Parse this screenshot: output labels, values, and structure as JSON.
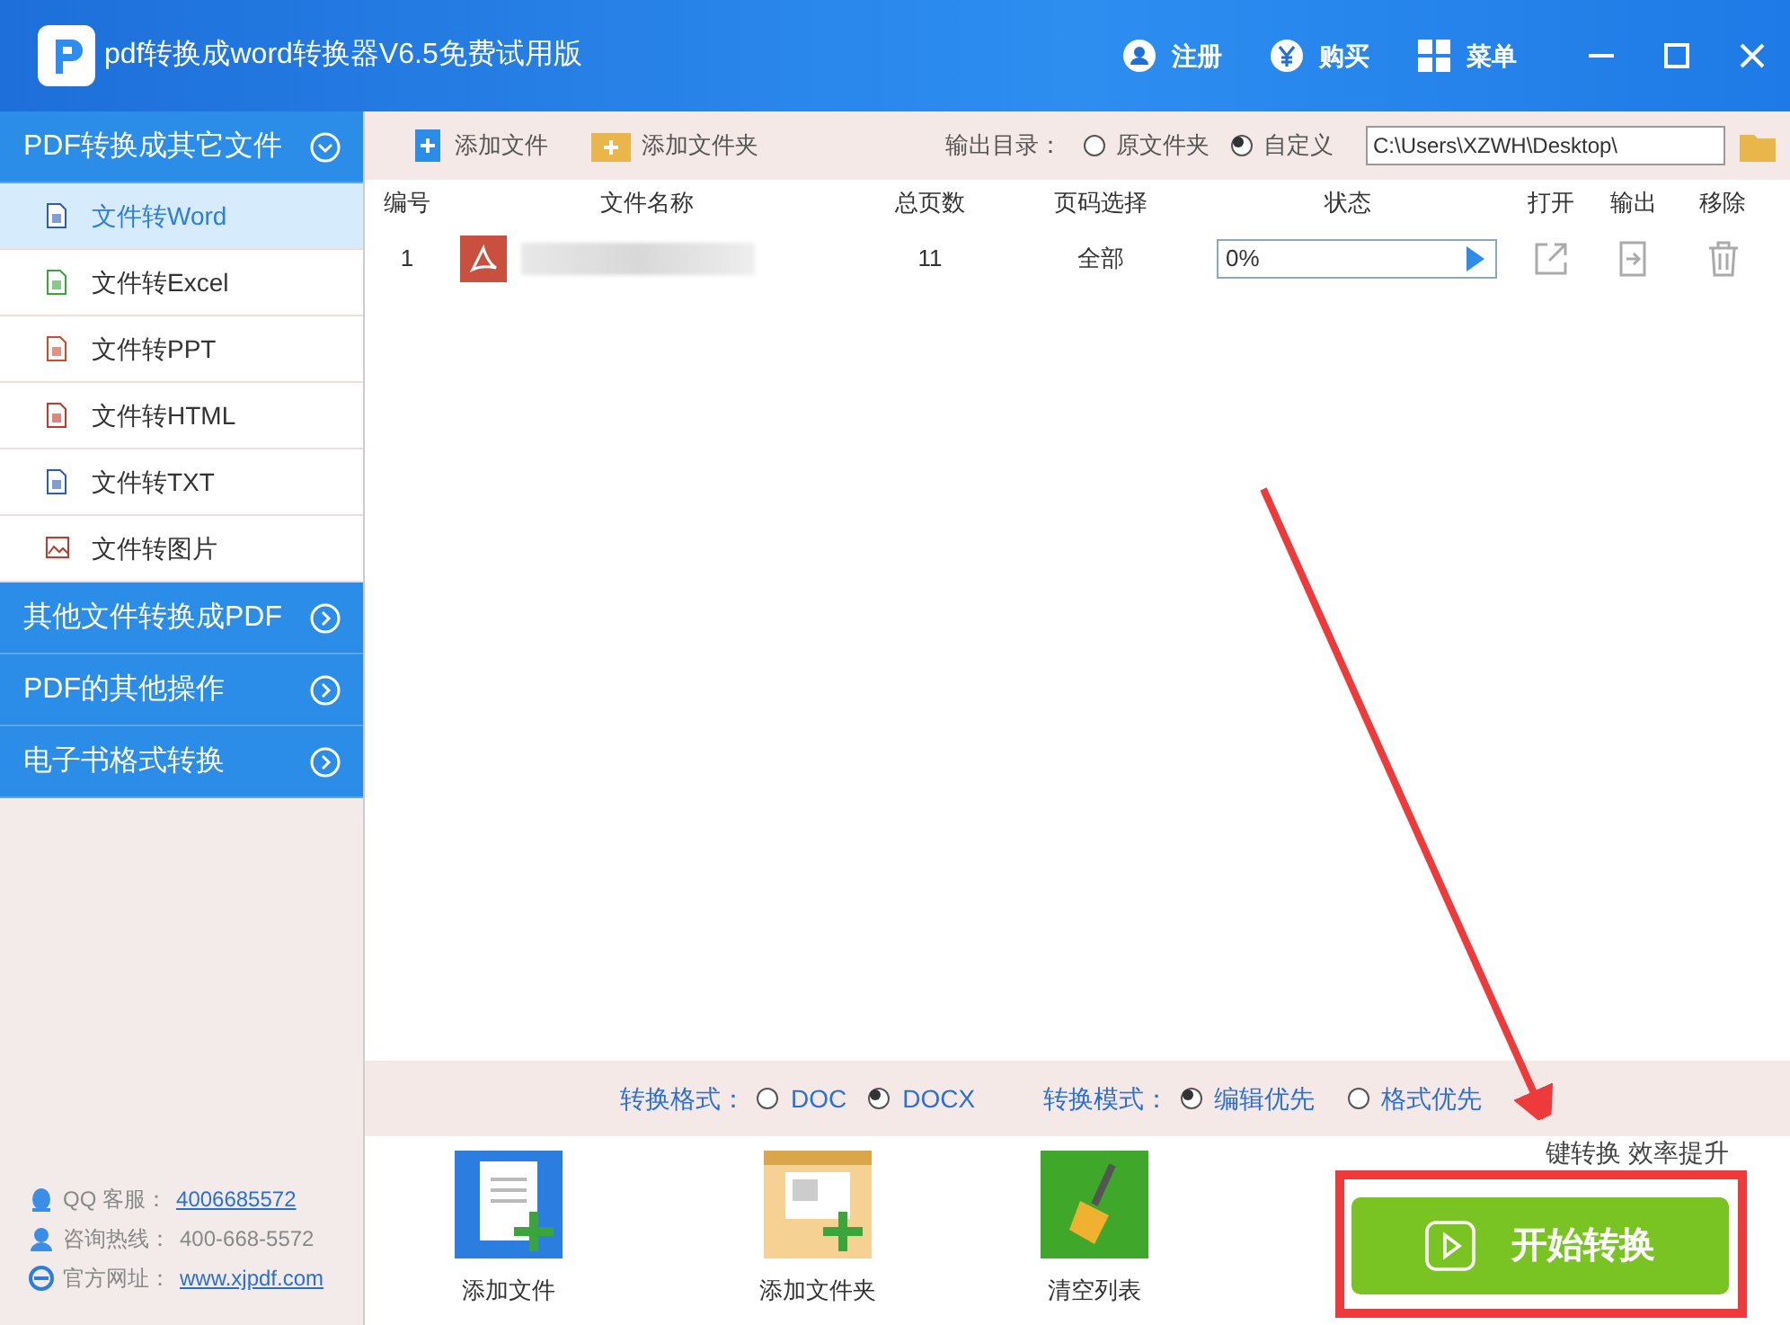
{
  "window": {
    "title": "pdf转换成word转换器V6.5免费试用版",
    "actions": [
      {
        "kind": "user",
        "label": "注册"
      },
      {
        "kind": "yen",
        "label": "购买"
      },
      {
        "kind": "grid",
        "label": "菜单"
      }
    ]
  },
  "sidebar": {
    "groups": [
      {
        "label": "PDF转换成其它文件",
        "expanded": true,
        "items": [
          {
            "label": "文件转Word",
            "kind": "word",
            "selected": true
          },
          {
            "label": "文件转Excel",
            "kind": "excel",
            "selected": false
          },
          {
            "label": "文件转PPT",
            "kind": "ppt",
            "selected": false
          },
          {
            "label": "文件转HTML",
            "kind": "html",
            "selected": false
          },
          {
            "label": "文件转TXT",
            "kind": "txt",
            "selected": false
          },
          {
            "label": "文件转图片",
            "kind": "image",
            "selected": false
          }
        ]
      },
      {
        "label": "其他文件转换成PDF",
        "expanded": false
      },
      {
        "label": "PDF的其他操作",
        "expanded": false
      },
      {
        "label": "电子书格式转换",
        "expanded": false
      }
    ],
    "contacts": [
      {
        "kind": "qq",
        "label": "QQ 客服：",
        "value": "4006685572",
        "link": true
      },
      {
        "kind": "phone",
        "label": "咨询热线：",
        "value": "400-668-5572",
        "link": false
      },
      {
        "kind": "web",
        "label": "官方网址：",
        "value": "www.xjpdf.com",
        "link": true
      }
    ]
  },
  "toolbar": {
    "buttons": [
      {
        "kind": "file",
        "label": "添加文件"
      },
      {
        "kind": "folder",
        "label": "添加文件夹"
      }
    ],
    "output_label": "输出目录：",
    "output_options": [
      {
        "label": "原文件夹",
        "selected": false
      },
      {
        "label": "自定义",
        "selected": true
      }
    ],
    "output_path": "C:\\Users\\XZWH\\Desktop\\"
  },
  "table": {
    "columns": [
      "编号",
      "文件名称",
      "总页数",
      "页码选择",
      "状态",
      "打开",
      "输出",
      "移除"
    ],
    "rows": [
      {
        "number": "1",
        "pages": "11",
        "range": "全部",
        "progress": "0%",
        "level": 0
      }
    ]
  },
  "format_bar": {
    "format_label": "转换格式：",
    "formats": [
      {
        "label": "DOC",
        "selected": false
      },
      {
        "label": "DOCX",
        "selected": true
      }
    ],
    "mode_label": "转换模式：",
    "modes": [
      {
        "label": "编辑优先",
        "selected": true
      },
      {
        "label": "格式优先",
        "selected": false
      }
    ]
  },
  "actions": [
    {
      "kind": "file",
      "label": "添加文件"
    },
    {
      "kind": "folder",
      "label": "添加文件夹"
    },
    {
      "kind": "clear",
      "label": "清空列表"
    }
  ],
  "start": {
    "hint": "键转换  效率提升",
    "label": "开始转换"
  }
}
